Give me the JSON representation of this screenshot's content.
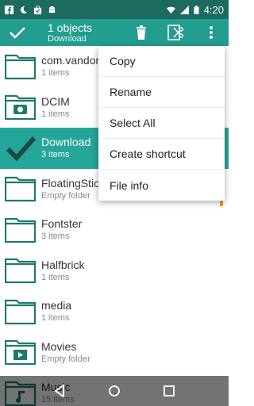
{
  "status_bar": {
    "time": "4:20"
  },
  "toolbar": {
    "count": "1 objects",
    "folder": "Download"
  },
  "files": [
    {
      "name": "com.vandor",
      "sub": "1 items",
      "icon": "folder-icon"
    },
    {
      "name": "DCIM",
      "sub": "1 items",
      "icon": "camera-folder-icon"
    },
    {
      "name": "Download",
      "sub": "3 items",
      "icon": "checkmark-icon",
      "selected": true
    },
    {
      "name": "FloatingStic",
      "sub": "Empty folder",
      "icon": "folder-icon"
    },
    {
      "name": "Fontster",
      "sub": "3 items",
      "icon": "folder-icon"
    },
    {
      "name": "Halfbrick",
      "sub": "1 items",
      "icon": "folder-icon"
    },
    {
      "name": "media",
      "sub": "1 items",
      "icon": "folder-icon"
    },
    {
      "name": "Movies",
      "sub": "Empty folder",
      "icon": "movie-folder-icon"
    },
    {
      "name": "Music",
      "sub": "15 items",
      "icon": "music-folder-icon"
    }
  ],
  "menu": [
    "Copy",
    "Rename",
    "Select All",
    "Create shortcut",
    "File info"
  ],
  "colors": {
    "accent": "#26a69a",
    "status": "#1d6b5f",
    "folder": "#1f7a6c"
  }
}
